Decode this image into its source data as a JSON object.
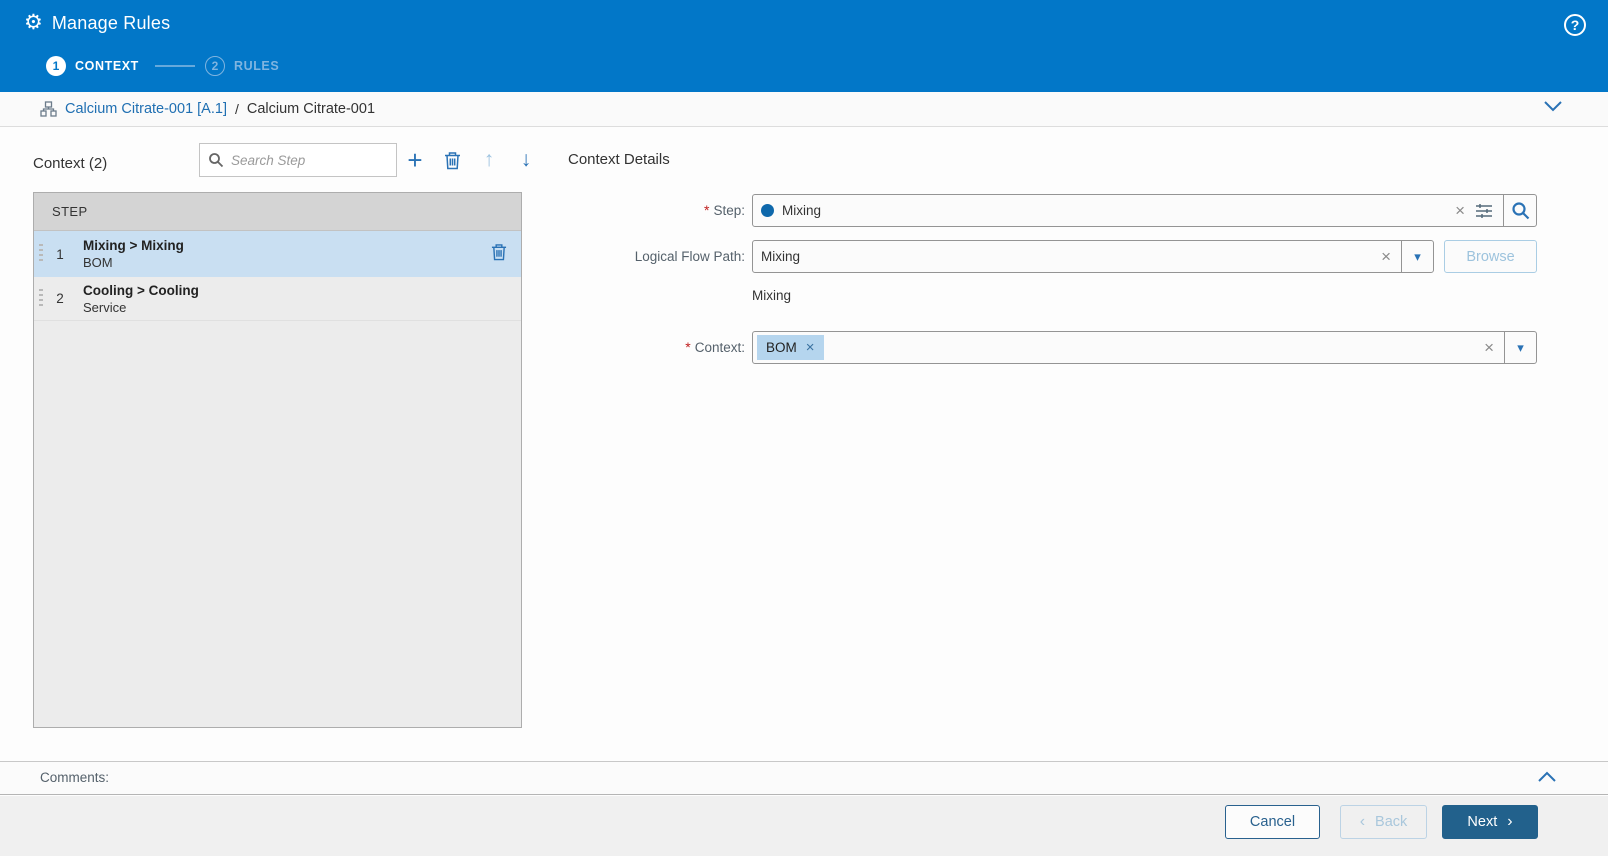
{
  "colors": {
    "header_blue": "#0277c8",
    "accent_blue": "#2a72b5",
    "link_blue": "#1f6fb2",
    "selected_row_blue": "#c9dff2",
    "next_button_blue": "#22618c",
    "required_red": "#c02020"
  },
  "icons": {
    "gear": "⚙",
    "help": "?",
    "plus": "+",
    "arrow_up": "↑",
    "arrow_down": "↓",
    "clear": "×",
    "dropdown": "▾",
    "chevron_left": "‹",
    "chevron_right": "›",
    "asterisk": "*",
    "slash": "/"
  },
  "header": {
    "title": "Manage Rules",
    "steps": [
      {
        "number": "1",
        "label": "CONTEXT"
      },
      {
        "number": "2",
        "label": "RULES"
      }
    ]
  },
  "breadcrumb": {
    "link": "Calcium Citrate-001 [A.1]",
    "current": "Calcium Citrate-001"
  },
  "context_list": {
    "title": "Context (2)",
    "search_placeholder": "Search Step",
    "column_header": "STEP",
    "rows": [
      {
        "index": "1",
        "title": "Mixing > Mixing",
        "subtitle": "BOM"
      },
      {
        "index": "2",
        "title": "Cooling > Cooling",
        "subtitle": "Service"
      }
    ]
  },
  "details": {
    "title": "Context Details",
    "step": {
      "label": "Step:",
      "value": "Mixing"
    },
    "logical_flow_path": {
      "label": "Logical Flow Path:",
      "value": "Mixing",
      "browse": "Browse",
      "path_text": "Mixing"
    },
    "context": {
      "label": "Context:",
      "chip": "BOM"
    }
  },
  "comments": {
    "label": "Comments:"
  },
  "footer": {
    "cancel": "Cancel",
    "back": "Back",
    "next": "Next"
  }
}
